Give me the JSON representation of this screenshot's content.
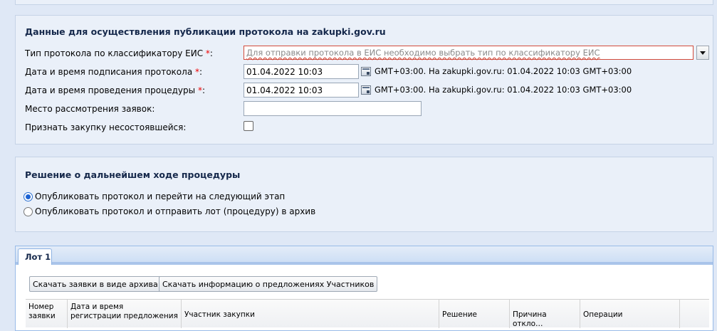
{
  "publication": {
    "title": "Данные для осуществления публикации протокола на zakupki.gov.ru",
    "protocol_type_label": "Тип протокола по классификатору ЕИС",
    "protocol_type_placeholder": "Для отправки протокола в ЕИС необходимо выбрать тип по классификатору ЕИС",
    "sign_label": "Дата и время подписания протокола",
    "sign_value": "01.04.2022 10:03",
    "sign_tz": "GMT+03:00. На zakupki.gov.ru: 01.04.2022 10:03 GMT+03:00",
    "procedure_label": "Дата и время проведения процедуры",
    "procedure_value": "01.04.2022 10:03",
    "procedure_tz": "GMT+03:00. На zakupki.gov.ru: 01.04.2022 10:03 GMT+03:00",
    "place_label": "Место рассмотрения заявок:",
    "place_value": "",
    "failed_label": "Признать закупку несостоявшейся:",
    "required_mark": "*",
    "colon": ":"
  },
  "decision": {
    "title": "Решение о дальнейшем ходе процедуры",
    "options": [
      {
        "label": "Опубликовать протокол и перейти на следующий этап",
        "selected": true
      },
      {
        "label": "Опубликовать протокол и отправить лот (процедуру) в архив",
        "selected": false
      }
    ]
  },
  "lot": {
    "tab_label": "Лот 1",
    "download_archive_label": "Скачать заявки в виде архива",
    "download_info_label": "Скачать информацию о предложениях Участников",
    "columns": {
      "number": [
        "Номер",
        "заявки"
      ],
      "date": [
        "Дата и время",
        "регистрации предложения"
      ],
      "participant": "Участник закупки",
      "decision": "Решение",
      "reason": "Причина откло…",
      "operations": "Операции"
    }
  }
}
